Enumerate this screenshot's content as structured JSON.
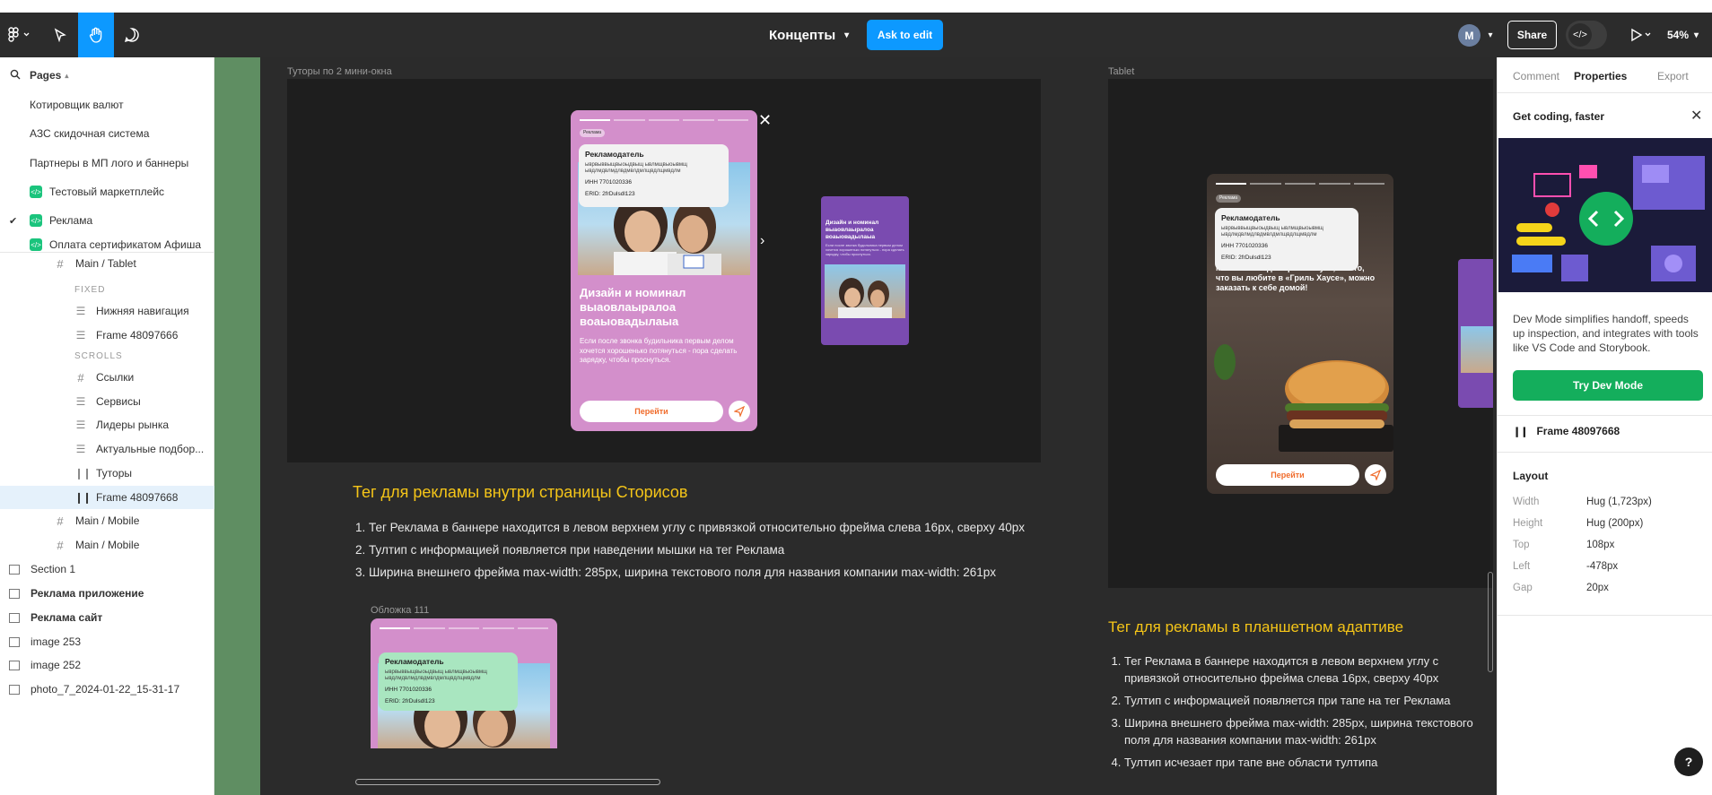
{
  "toolbar": {
    "doc_title": "Концепты",
    "ask_edit": "Ask to edit",
    "avatar_initial": "M",
    "share": "Share",
    "zoom": "54%"
  },
  "sidebar": {
    "pages_label": "Pages",
    "pages": [
      {
        "label": "Котировщик валют"
      },
      {
        "label": "АЗС скидочная система"
      },
      {
        "label": "Партнеры в МП лого и баннеры"
      },
      {
        "label": "Тестовый маркетплейс"
      },
      {
        "label": "Реклама"
      },
      {
        "label": "Оплата сертификатом Афиша"
      }
    ],
    "layers": {
      "main_tablet": "Main / Tablet",
      "fixed": "FIXED",
      "bottom_nav": "Нижняя навигация",
      "frame_a": "Frame 48097666",
      "scrolls": "SCROLLS",
      "links": "Ссылки",
      "services": "Сервисы",
      "leaders": "Лидеры рынка",
      "actual": "Актуальные подбор...",
      "tutors": "Туторы",
      "frame_b": "Frame 48097668",
      "main_mobile_1": "Main / Mobile",
      "main_mobile_2": "Main / Mobile",
      "section1": "Section 1",
      "ad_app": "Реклама приложение",
      "ad_site": "Реклама сайт",
      "img253": "image 253",
      "img252": "image 252",
      "photo": "photo_7_2024-01-22_15-31-17"
    }
  },
  "canvas": {
    "frame1_label": "Туторы по 2 мини-окна",
    "frame2_label": "Tablet",
    "cover_label": "Обложка 111",
    "story": {
      "tag": "Реклама",
      "tooltip_title": "Рекламодатель",
      "tooltip_company": "ыврвыввыщвыоыдвыщ ывлмщвыоывмщ ывдлмдвлмдлвдмвлдмлщвдлщмвдлм",
      "tooltip_inn": "ИНН 7701020336",
      "tooltip_erid": "ERID: 2frDulsdl123",
      "title": "Дизайн и номинал выаовлаыралоа воаыовадылаыа",
      "text": "Если после звонка будильника первым делом хочется хорошенько потянуться - пора сделать зарядку, чтобы проснуться.",
      "button": "Перейти"
    },
    "mini_story": {
      "title": "Дизайн и номинал выаовлаыралоа воаыовадылаыа",
      "text": "Если после звонка будильника первым делом хочется хорошенько потянуться - пора сделать зарядку, чтобы проснуться."
    },
    "tablet_story": {
      "text": "Мясные блюда «Гриль Хаус», все то, что вы любите в «Гриль Хаусе», можно заказать к себе домой!",
      "button": "Перейти"
    },
    "heading1": "Тег для рекламы внутри страницы Сторисов",
    "list1": [
      "Тег Реклама в баннере находится в левом верхнем углу с привязкой относительно фрейма слева 16px, сверху 40px",
      "Тултип с информацией появляется при наведении мышки на тег Реклама",
      "Ширина внешнего фрейма max-width: 285px, ширина текстового поля для названия компании max-width: 261px"
    ],
    "heading2": "Тег для рекламы в планшетном адаптиве",
    "list2": [
      "Тег Реклама в баннере находится в левом верхнем углу с привязкой относительно фрейма слева 16px, сверху 40px",
      "Тултип с информацией появляется при тапе на тег Реклама",
      "Ширина внешнего фрейма max-width: 285px, ширина текстового поля для названия компании max-width: 261px",
      "Тултип исчезает при тапе вне области тултипа"
    ]
  },
  "right_panel": {
    "tabs": [
      "Comment",
      "Properties",
      "Export"
    ],
    "promo_title": "Get coding, faster",
    "promo_text": "Dev Mode simplifies handoff, speeds up inspection, and integrates with tools like VS Code and Storybook.",
    "promo_button": "Try Dev Mode",
    "frame_name": "Frame 48097668",
    "layout_heading": "Layout",
    "props": [
      {
        "key": "Width",
        "value": "Hug (1,723px)"
      },
      {
        "key": "Height",
        "value": "Hug (200px)"
      },
      {
        "key": "Top",
        "value": "108px"
      },
      {
        "key": "Left",
        "value": "-478px"
      },
      {
        "key": "Gap",
        "value": "20px"
      }
    ]
  },
  "colors": {
    "accent": "#0d99ff",
    "heading_yellow": "#f5c518",
    "dev_green": "#14ae5c",
    "story_pink": "#d38fcb"
  }
}
